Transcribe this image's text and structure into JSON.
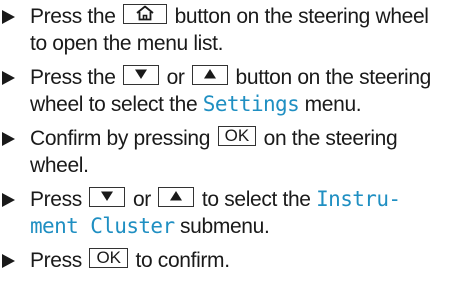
{
  "steps": [
    {
      "line1_a": "Press the",
      "line1_b": "button on the steering wheel",
      "line2": "to open the menu list.",
      "button_icon": "home-icon"
    },
    {
      "line1_a": "Press the",
      "line1_b": "or",
      "line1_c": "button on the steering",
      "line2_a": "wheel to select the",
      "term": "Settings",
      "line2_b": "menu.",
      "button1_icon": "down-arrow-icon",
      "button2_icon": "up-arrow-icon"
    },
    {
      "line1_a": "Confirm by pressing",
      "button_label": "OK",
      "line1_b": "on the steering",
      "line2": "wheel."
    },
    {
      "line1_a": "Press",
      "line1_b": "or",
      "line1_c": "to select the",
      "term_part1": "Instru-",
      "term_part2": "ment Cluster",
      "line2_b": "submenu.",
      "button1_icon": "down-arrow-icon",
      "button2_icon": "up-arrow-icon"
    },
    {
      "line1_a": "Press",
      "button_label": "OK",
      "line1_b": "to confirm."
    }
  ],
  "colors": {
    "text": "#1a1a1a",
    "menu_term": "#1f8fc2",
    "button_border": "#333333"
  }
}
